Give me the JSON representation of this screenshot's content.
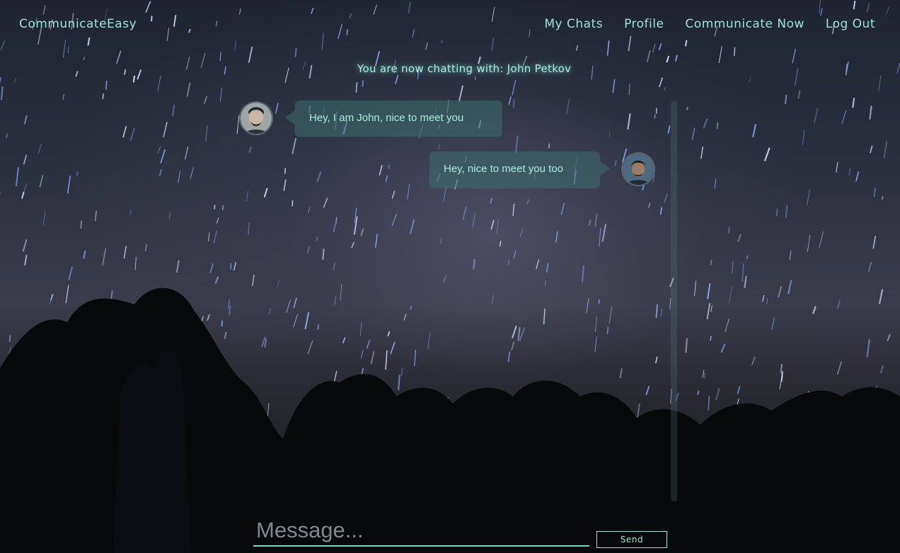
{
  "header": {
    "brand": "CommunicateEasy",
    "nav": [
      "My Chats",
      "Profile",
      "Communicate Now",
      "Log Out"
    ]
  },
  "chat": {
    "status": "You are now chatting with: John Petkov",
    "messages": [
      {
        "side": "left",
        "text": "Hey, I am John, nice to meet you"
      },
      {
        "side": "right",
        "text": "Hey, nice to meet you too"
      }
    ]
  },
  "composer": {
    "placeholder": "Message...",
    "value": "",
    "send_label": "Send"
  },
  "colors": {
    "accent": "#9fe3d6",
    "bubble": "#3c6e6e"
  }
}
